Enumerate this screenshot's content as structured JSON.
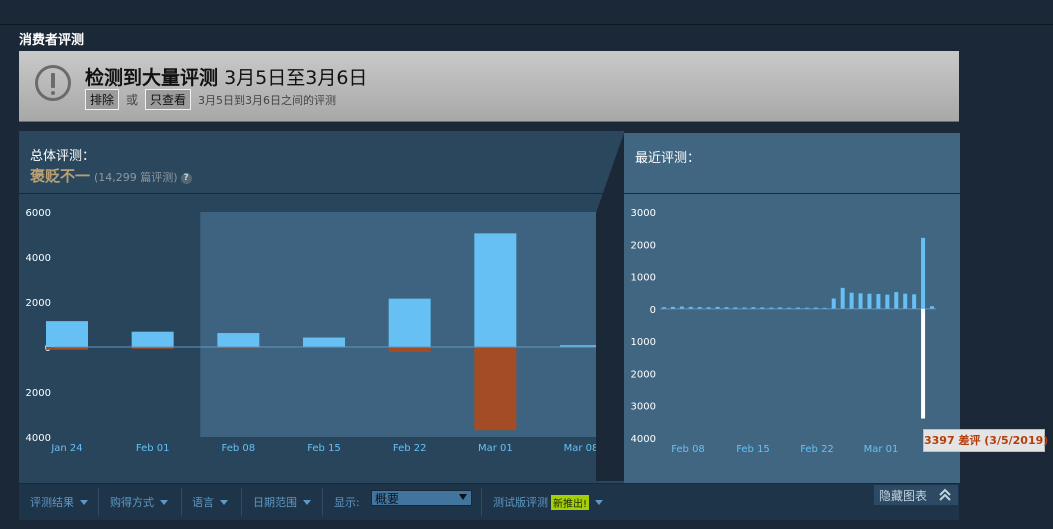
{
  "section_title": "消费者评测",
  "alert": {
    "title_bold": "检测到大量评测",
    "title_rest": "3月5日至3月6日",
    "exclude_label": "排除",
    "or_label": "或",
    "only_view_label": "只查看",
    "description": "3月5日到3月6日之间的评测"
  },
  "overall": {
    "label": "总体评测：",
    "rating": "褒贬不一",
    "count_text": "(14,299 篇评测)",
    "help_icon": "?"
  },
  "recent": {
    "label": "最近评测："
  },
  "colors": {
    "positive": "#66c0f4",
    "negative": "#a34c25",
    "highlight_bg": "#3d6380",
    "mixed": "#b9a074"
  },
  "chart_data": [
    {
      "type": "bar",
      "title": "总体评测",
      "yticks_pos": [
        "6000",
        "4000",
        "2000",
        "0"
      ],
      "yticks_neg": [
        "2000",
        "4000"
      ],
      "ylim": [
        -4000,
        6000
      ],
      "x_labels": [
        "Jan 24",
        "Feb 01",
        "Feb 08",
        "Feb 15",
        "Feb 22",
        "Mar 01",
        "Mar 08"
      ],
      "highlight_range": [
        "Feb 08",
        "Mar 08"
      ],
      "series": [
        {
          "name": "positive",
          "values": [
            1150,
            680,
            620,
            420,
            2150,
            5050,
            80
          ]
        },
        {
          "name": "negative",
          "values": [
            -120,
            -80,
            -60,
            -40,
            -220,
            -3700,
            -30
          ]
        }
      ]
    },
    {
      "type": "bar",
      "title": "最近评测",
      "yticks_pos": [
        "3000",
        "2000",
        "1000",
        "0"
      ],
      "yticks_neg": [
        "1000",
        "2000",
        "3000",
        "4000"
      ],
      "ylim": [
        -4000,
        3000
      ],
      "x_labels": [
        "Feb 08",
        "Feb 15",
        "Feb 22",
        "Mar 01"
      ],
      "series": [
        {
          "name": "positive",
          "values": [
            50,
            60,
            70,
            60,
            55,
            50,
            60,
            50,
            45,
            40,
            50,
            45,
            40,
            45,
            35,
            40,
            35,
            40,
            30,
            320,
            650,
            500,
            480,
            470,
            460,
            440,
            520,
            470,
            450,
            2200,
            80
          ]
        },
        {
          "name": "negative",
          "values": [
            -5,
            -5,
            -5,
            -5,
            -5,
            -5,
            -5,
            -5,
            -5,
            -5,
            -5,
            -5,
            -5,
            -5,
            -5,
            -5,
            -5,
            -5,
            -5,
            -10,
            -15,
            -12,
            -12,
            -12,
            -10,
            -10,
            -12,
            -12,
            -10,
            -3397,
            -10
          ]
        }
      ],
      "tooltip": "3397 差评 (3/5/2019)"
    }
  ],
  "filters": {
    "review_type": "评测结果",
    "purchase_type": "购得方式",
    "language": "语言",
    "date_range": "日期范围",
    "display_label": "显示:",
    "display_value": "概要",
    "beta_label": "测试版评测",
    "beta_badge": "新推出!",
    "hide_chart": "隐藏图表"
  }
}
